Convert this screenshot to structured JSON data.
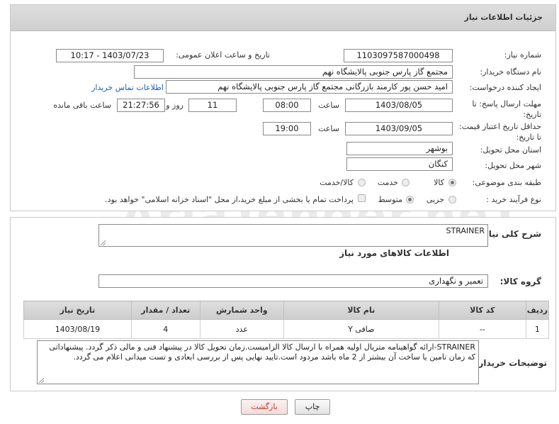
{
  "header": {
    "title": "جزئیات اطلاعات نیاز"
  },
  "fields": {
    "need_number_label": "شماره نیاز:",
    "need_number": "1103097587000498",
    "announce_label": "تاریخ و ساعت اعلان عمومی:",
    "announce_value": "1403/07/23 - 10:17",
    "buyer_label": "نام دستگاه خریدار:",
    "buyer_value": "مجتمع گاز پارس جنوبی  پالایشگاه نهم",
    "creator_label": "ایجاد کننده درخواست:",
    "creator_value": "امید حسن پور کارمند بازرگانی مجتمع گاز پارس جنوبی  پالایشگاه نهم",
    "contact_link": "اطلاعات تماس خریدار",
    "reply_deadline_label": "مهلت ارسال پاسخ: تا تاریخ:",
    "reply_date": "1403/08/05",
    "time_word": "ساعت",
    "reply_time": "08:00",
    "days_count": "11",
    "days_word": "روز و",
    "remaining_time": "21:27:56",
    "remaining_word": "ساعت باقی مانده",
    "price_validity_label": "حداقل تاریخ اعتبار قیمت: تا تاریخ:",
    "price_date": "1403/09/05",
    "price_time": "19:00",
    "province_label": "استان محل تحویل:",
    "province_value": "بوشهر",
    "city_label": "شهر محل تحویل:",
    "city_value": "کنگان",
    "category_label": "طبقه بندی موضوعی:",
    "category_options": [
      "کالا",
      "خدمت",
      "کالا/خدمت"
    ],
    "process_label": "نوع فرآیند خرید :",
    "process_options": [
      "جزیی",
      "متوسط"
    ],
    "payment_note": "پرداخت تمام یا بخشی از مبلغ خرید،از محل \"اسناد خزانه اسلامی\" خواهد بود."
  },
  "summary": {
    "description_label": "شرح کلی نیاز:",
    "description_value": "STRAINER",
    "goods_info_title": "اطلاعات کالاهای مورد نیاز",
    "goods_group_label": "گروه کالا:",
    "goods_group_value": "تعمیر و نگهداری"
  },
  "table": {
    "headers": [
      "ردیف",
      "کد کالا",
      "نام کالا",
      "واحد شمارش",
      "تعداد / مقدار",
      "تاریخ نیاز"
    ],
    "rows": [
      [
        "1",
        "--",
        "صافی Y",
        "عدد",
        "4",
        "1403/08/19"
      ]
    ]
  },
  "buyer_notes": {
    "label": "توضیحات خریدار:",
    "text": "STRAINER-ارائه گواهینامه متریال اولیه همراه با ارسال کالا الزامیست.زمان تحویل کالا در پیشنهاد فنی و مالی ذکر گردد. پیشنهاداتی که زمان تامین یا ساخت آن بیشتر از 2 ماه باشد مردود است.تایید نهایی پس از بررسی ابعادی و تست میدانی اعلام می گردد."
  },
  "buttons": {
    "print": "چاپ",
    "back": "بازگشت"
  },
  "watermark": "AriaTender.neT",
  "colors": {
    "link": "#1a5fb4",
    "back_button_text": "#c0392b"
  }
}
